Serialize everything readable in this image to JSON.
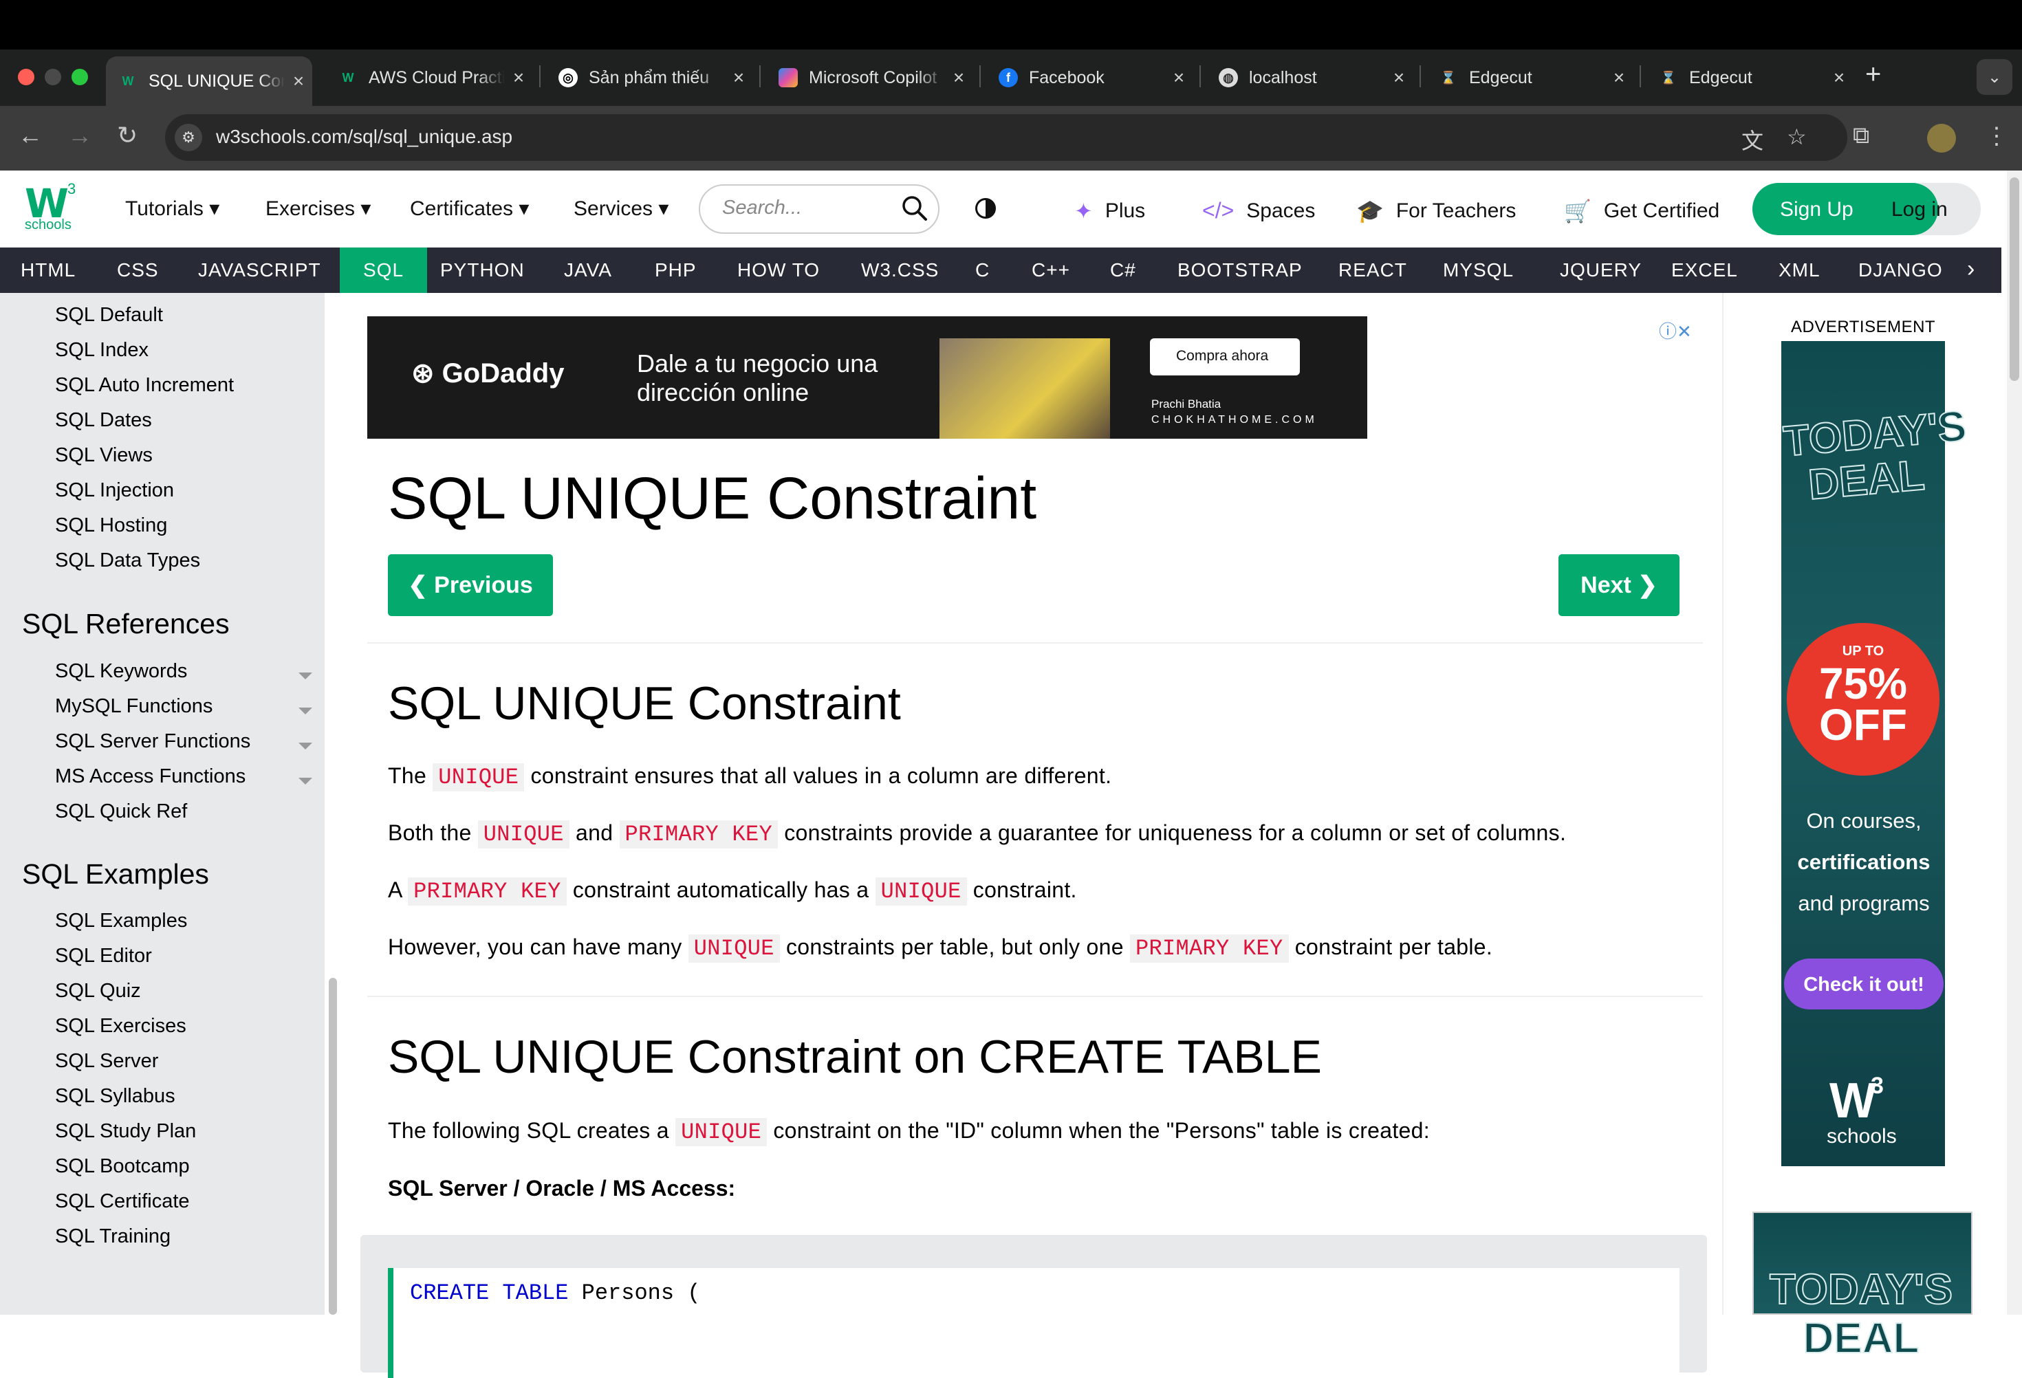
{
  "browser": {
    "tabs": [
      {
        "title": "SQL UNIQUE Constraint",
        "favicon": "w3schools-icon",
        "active": true
      },
      {
        "title": "AWS Cloud Practitioner",
        "favicon": "w3schools-icon",
        "active": false
      },
      {
        "title": "Sản phẩm thiếu",
        "favicon": "openai-icon",
        "active": false
      },
      {
        "title": "Microsoft Copilot",
        "favicon": "copilot-icon",
        "active": false
      },
      {
        "title": "Facebook",
        "favicon": "facebook-icon",
        "active": false
      },
      {
        "title": "localhost",
        "favicon": "globe-icon",
        "active": false
      },
      {
        "title": "Edgecut",
        "favicon": "edgecut-icon",
        "active": false
      },
      {
        "title": "Edgecut",
        "favicon": "edgecut-icon",
        "active": false
      }
    ],
    "url": "w3schools.com/sql/sql_unique.asp"
  },
  "topnav": {
    "menus": [
      "Tutorials",
      "Exercises",
      "Certificates",
      "Services"
    ],
    "search_placeholder": "Search...",
    "items": [
      "Plus",
      "Spaces",
      "For Teachers",
      "Get Certified"
    ],
    "signup": "Sign Up",
    "login": "Log in",
    "brand_color": "#04aa6d"
  },
  "langbar": [
    "HTML",
    "CSS",
    "JAVASCRIPT",
    "SQL",
    "PYTHON",
    "JAVA",
    "PHP",
    "HOW TO",
    "W3.CSS",
    "C",
    "C++",
    "C#",
    "BOOTSTRAP",
    "REACT",
    "MYSQL",
    "JQUERY",
    "EXCEL",
    "XML",
    "DJANGO"
  ],
  "langbar_active": "SQL",
  "sidebar": {
    "items_top": [
      "SQL Default",
      "SQL Index",
      "SQL Auto Increment",
      "SQL Dates",
      "SQL Views",
      "SQL Injection",
      "SQL Hosting",
      "SQL Data Types"
    ],
    "references_heading": "SQL References",
    "references": [
      "SQL Keywords",
      "MySQL Functions",
      "SQL Server Functions",
      "MS Access Functions",
      "SQL Quick Ref"
    ],
    "examples_heading": "SQL Examples",
    "examples": [
      "SQL Examples",
      "SQL Editor",
      "SQL Quiz",
      "SQL Exercises",
      "SQL Server",
      "SQL Syllabus",
      "SQL Study Plan",
      "SQL Bootcamp",
      "SQL Certificate",
      "SQL Training"
    ]
  },
  "ad_top": {
    "brand": "GoDaddy",
    "slogan": "Dale a tu negocio una dirección online",
    "cta": "Compra ahora",
    "name": "Prachi Bhatia",
    "site": "CHOKHATHOME.COM"
  },
  "main": {
    "title": "SQL UNIQUE Constraint",
    "prev": "Previous",
    "next": "Next",
    "section1_title": "SQL UNIQUE Constraint",
    "p1": {
      "a": "The ",
      "code1": "UNIQUE",
      "b": " constraint ensures that all values in a column are different."
    },
    "p2": {
      "a": "Both the ",
      "code1": "UNIQUE",
      "b": " and ",
      "code2": "PRIMARY KEY",
      "c": " constraints provide a guarantee for uniqueness for a column or set of columns."
    },
    "p3": {
      "a": "A ",
      "code1": "PRIMARY KEY",
      "b": " constraint automatically has a ",
      "code2": "UNIQUE",
      "c": " constraint."
    },
    "p4": {
      "a": "However, you can have many ",
      "code1": "UNIQUE",
      "b": " constraints per table, but only one ",
      "code2": "PRIMARY KEY",
      "c": " constraint per table."
    },
    "section2_title": "SQL UNIQUE Constraint on CREATE TABLE",
    "p5": {
      "a": "The following SQL creates a ",
      "code1": "UNIQUE",
      "b": " constraint on the \"ID\" column when the \"Persons\" table is created:"
    },
    "db_label": "SQL Server / Oracle / MS Access:",
    "code": {
      "kw1": "CREATE",
      "kw2": "TABLE",
      "rest": " Persons ("
    }
  },
  "ad_right": {
    "label": "ADVERTISEMENT",
    "title": "TODAY'S DEAL",
    "upto": "UP TO",
    "percent": "75% OFF",
    "line1": "On courses,",
    "line2": "certifications",
    "line3": "and programs",
    "button": "Check it out!",
    "logo_sub": "schools"
  }
}
